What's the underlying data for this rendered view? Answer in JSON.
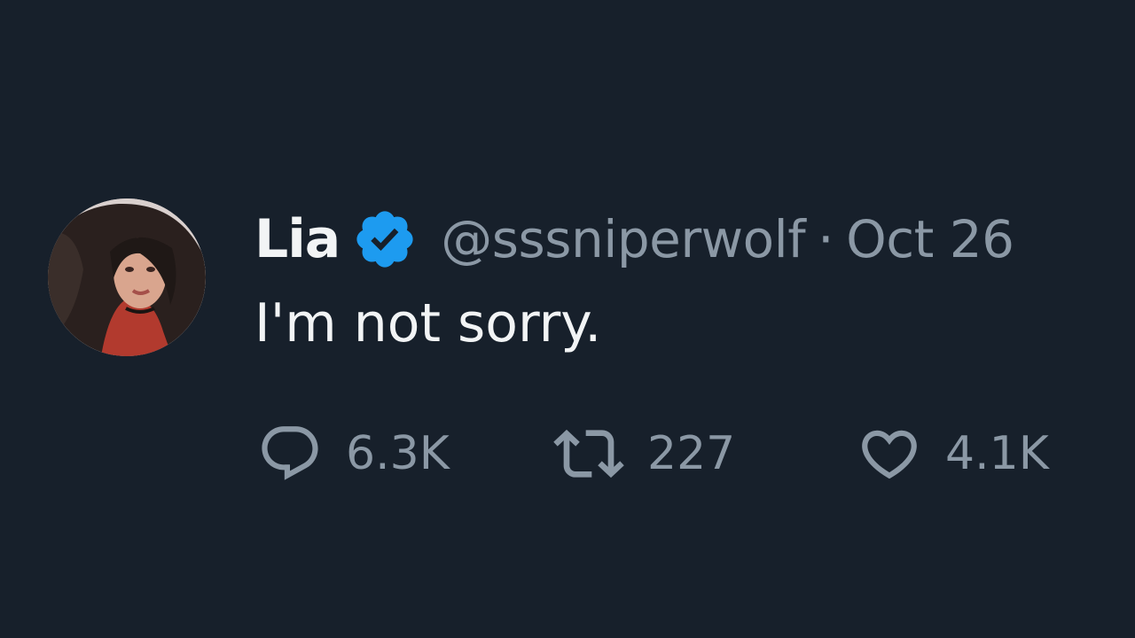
{
  "tweet": {
    "author_name": "Lia",
    "handle": "@sssniperwolf",
    "separator": "·",
    "date": "Oct 26",
    "text": "I'm not sorry.",
    "verified": true
  },
  "actions": {
    "replies": {
      "icon": "reply-icon",
      "count": "6.3K"
    },
    "retweets": {
      "icon": "retweet-icon",
      "count": "227"
    },
    "likes": {
      "icon": "heart-icon",
      "count": "4.1K"
    }
  },
  "colors": {
    "background": "#17202b",
    "primary_text": "#f2f4f5",
    "secondary_text": "#8b98a5",
    "verified_badge": "#1d9bf0"
  }
}
